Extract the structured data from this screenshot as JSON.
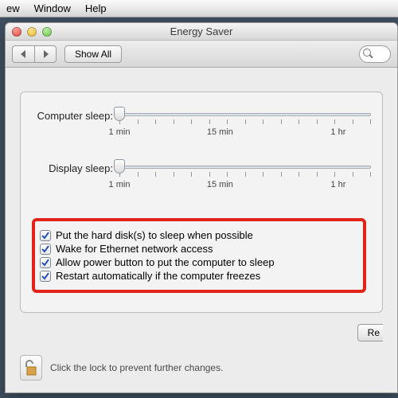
{
  "menubar": {
    "items": [
      "ew",
      "Window",
      "Help"
    ]
  },
  "window": {
    "title": "Energy Saver",
    "toolbar": {
      "show_all": "Show All"
    }
  },
  "sliders": {
    "computer": {
      "label": "Computer sleep:",
      "ticks_total": 15,
      "value_tick": 0,
      "labels": {
        "min": "1 min",
        "mid": "15 min",
        "max": "1 hr"
      }
    },
    "display": {
      "label": "Display sleep:",
      "ticks_total": 15,
      "value_tick": 0,
      "labels": {
        "min": "1 min",
        "mid": "15 min",
        "max": "1 hr"
      }
    }
  },
  "checkboxes": [
    {
      "checked": true,
      "label": "Put the hard disk(s) to sleep when possible"
    },
    {
      "checked": true,
      "label": "Wake for Ethernet network access"
    },
    {
      "checked": true,
      "label": "Allow power button to put the computer to sleep"
    },
    {
      "checked": true,
      "label": "Restart automatically if the computer freezes"
    }
  ],
  "buttons": {
    "restore_defaults_partial": "Re"
  },
  "footer": {
    "lock_text": "Click the lock to prevent further changes."
  }
}
